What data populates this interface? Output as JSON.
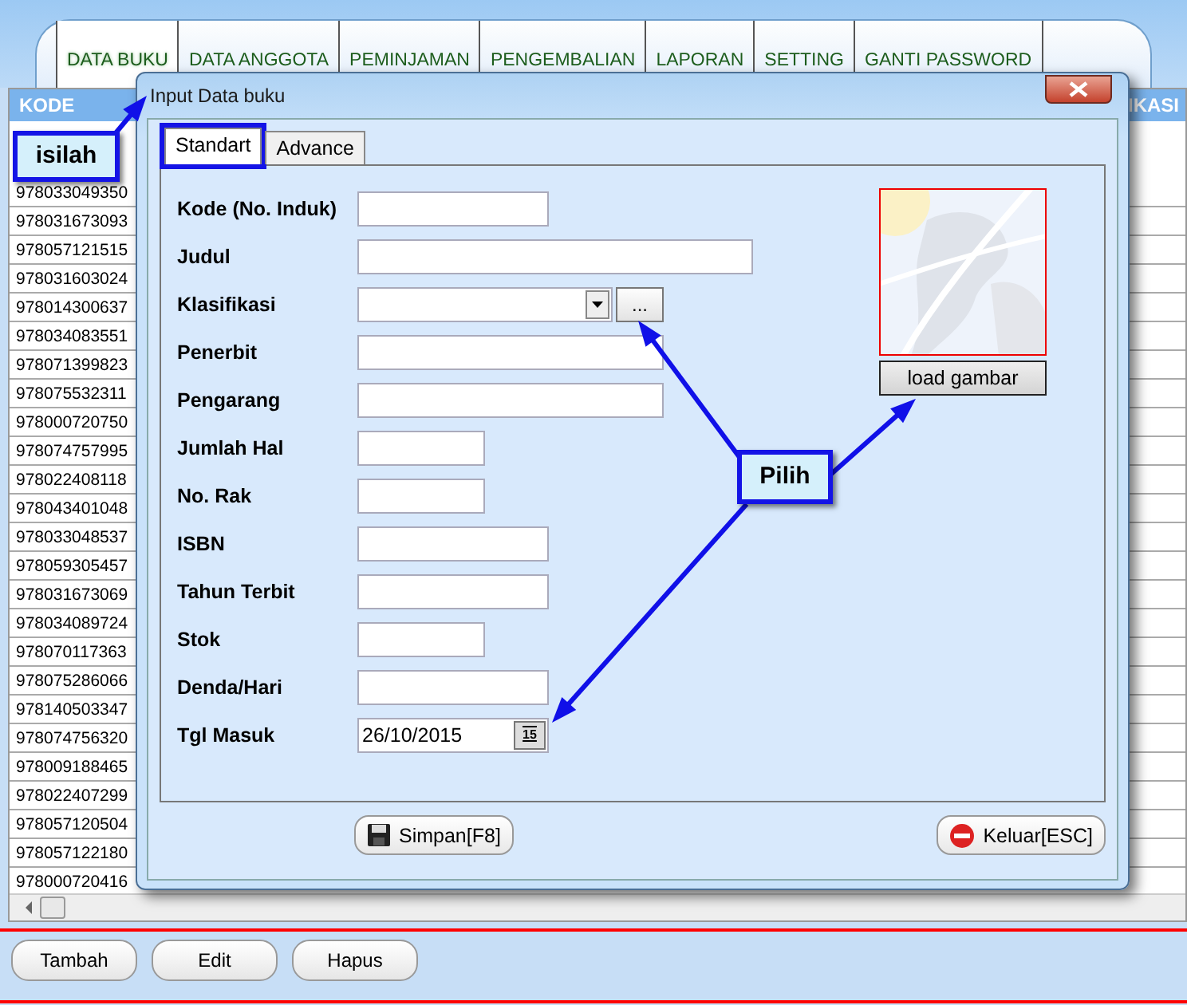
{
  "main_tabs": [
    {
      "label": "DATA BUKU",
      "selected": true
    },
    {
      "label": "DATA ANGGOTA",
      "selected": false
    },
    {
      "label": "PEMINJAMAN",
      "selected": false
    },
    {
      "label": "PENGEMBALIAN",
      "selected": false
    },
    {
      "label": "LAPORAN",
      "selected": false
    },
    {
      "label": "SETTING",
      "selected": false
    },
    {
      "label": "GANTI PASSWORD",
      "selected": false
    }
  ],
  "table": {
    "columns": [
      "KODE",
      "IKASI"
    ],
    "rows": [
      "978033049350",
      "978031673093",
      "978057121515",
      "978031603024",
      "978014300637",
      "978034083551",
      "978071399823",
      "978075532311",
      "978000720750",
      "978074757995",
      "978022408118",
      "978043401048",
      "978033048537",
      "978059305457",
      "978031673069",
      "978034089724",
      "978070117363",
      "978075286066",
      "978140503347",
      "978074756320",
      "978009188465",
      "978022407299",
      "978057120504",
      "978057122180",
      "978000720416"
    ]
  },
  "bottom_buttons": [
    "Tambah",
    "Edit",
    "Hapus"
  ],
  "dialog": {
    "title": "Input Data buku",
    "tabs": [
      {
        "label": "Standart",
        "selected": true,
        "highlighted": true
      },
      {
        "label": "Advance",
        "selected": false,
        "highlighted": false
      }
    ],
    "fields": [
      {
        "label": "Kode (No. Induk)",
        "kind": "text"
      },
      {
        "label": "Judul",
        "kind": "text"
      },
      {
        "label": "Klasifikasi",
        "kind": "combo",
        "button": "..."
      },
      {
        "label": "Penerbit",
        "kind": "text"
      },
      {
        "label": "Pengarang",
        "kind": "text"
      },
      {
        "label": "Jumlah Hal",
        "kind": "text"
      },
      {
        "label": "No. Rak",
        "kind": "text"
      },
      {
        "label": "ISBN",
        "kind": "text"
      },
      {
        "label": "Tahun Terbit",
        "kind": "text"
      },
      {
        "label": "Stok",
        "kind": "text"
      },
      {
        "label": "Denda/Hari",
        "kind": "text"
      },
      {
        "label": "Tgl Masuk",
        "kind": "date",
        "value": "26/10/2015",
        "icon_text": "15"
      }
    ],
    "load_button": "load gambar",
    "save_button": "Simpan[F8]",
    "exit_button": "Keluar[ESC]"
  },
  "callouts": [
    "isilah",
    "Pilih"
  ]
}
